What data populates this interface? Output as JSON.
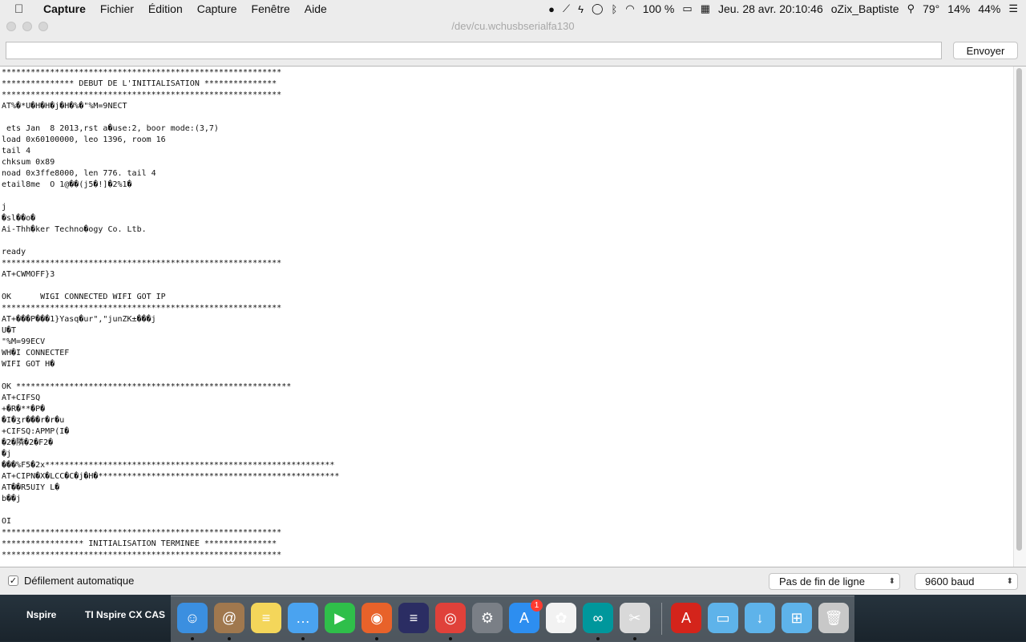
{
  "menubar": {
    "app": "Capture",
    "items": [
      "Fichier",
      "Édition",
      "Capture",
      "Fenêtre",
      "Aide"
    ],
    "battery": "100 %",
    "datetime": "Jeu. 28 avr.  20:10:46",
    "user": "oZix_Baptiste",
    "temperature": "79°",
    "cpu": "14%",
    "mem": "44%"
  },
  "window": {
    "title": "/dev/cu.wchusbserialfa130",
    "send_placeholder": "",
    "send_label": "Envoyer",
    "autoscroll_label": "Défilement automatique",
    "autoscroll_checked": true,
    "line_ending": "Pas de fin de ligne",
    "baud": "9600 baud"
  },
  "console_lines": [
    "**********************************************************",
    "*************** DEBUT DE L'INITIALISATION ***************",
    "**********************************************************",
    "AT%�*U�H�H�j�H�%�\"%M=9NECT",
    "",
    " ets Jan  8 2013,rst a�use:2, boor mode:(3,7)",
    "load 0x60100000, leo 1396, room 16",
    "tail 4",
    "chksum 0x89",
    "noad 0x3ffe8000, len 776. tail 4",
    "etail8me  O 1@��(j5�!]�2%1�",
    "",
    "j",
    "�sl��o�",
    "Ai-Thh�ker Techno�ogy Co. Ltb.",
    "",
    "ready",
    "**********************************************************",
    "AT+CWMOFF}3",
    "",
    "OK      WIGI CONNECTED WIFI GOT IP",
    "**********************************************************",
    "AT+���P���1}Yasq�ur\",\"junZK±���j",
    "U�T",
    "\"%M=99ECV",
    "WH�I CONNECTEF",
    "WIFI GOT H�",
    "",
    "OK *********************************************************",
    "AT+CIFSQ",
    "+�R�**�P�",
    "�I�ʒr���r�r�u",
    "+CIFSQ:APMP(I�",
    "�2�隣�2�F2�",
    "�j",
    "���%F5�2x************************************************************",
    "AT+CIPN�X�LCC�C�j�H�**************************************************",
    "AT��R5UIY L�",
    "b��j",
    "",
    "OI",
    "**********************************************************",
    "***************** INITIALISATION TERMINEE ***************",
    "**********************************************************"
  ],
  "desktop": {
    "label_left": "Nspire",
    "label_right": "TI Nspire CX CAS"
  },
  "dock": {
    "appstore_badge": "1",
    "icons": [
      {
        "name": "finder-icon",
        "color": "#3b8fe0",
        "glyph": "☺",
        "running": true
      },
      {
        "name": "contacts-icon",
        "color": "#a0784e",
        "glyph": "@",
        "running": true
      },
      {
        "name": "notes-icon",
        "color": "#f4d65a",
        "glyph": "≡",
        "running": false
      },
      {
        "name": "messages-icon",
        "color": "#4aa3f0",
        "glyph": "…",
        "running": true
      },
      {
        "name": "facetime-icon",
        "color": "#2fbf4a",
        "glyph": "▶",
        "running": false
      },
      {
        "name": "firefox-icon",
        "color": "#e8622a",
        "glyph": "◉",
        "running": true
      },
      {
        "name": "eclipse-icon",
        "color": "#2b2d63",
        "glyph": "≡",
        "running": false
      },
      {
        "name": "chrome-icon",
        "color": "#e0413a",
        "glyph": "◎",
        "running": true
      },
      {
        "name": "system-preferences-icon",
        "color": "#7a7f86",
        "glyph": "⚙",
        "running": false
      },
      {
        "name": "app-store-icon",
        "color": "#2d8ef0",
        "glyph": "A",
        "running": false
      },
      {
        "name": "photos-icon",
        "color": "#f2f2f2",
        "glyph": "✿",
        "running": false
      },
      {
        "name": "arduino-icon",
        "color": "#00979c",
        "glyph": "∞",
        "running": true
      },
      {
        "name": "capture-icon",
        "color": "#d9d9d9",
        "glyph": "✂",
        "running": true
      },
      {
        "name": "acrobat-icon",
        "color": "#d4241b",
        "glyph": "A",
        "running": false
      },
      {
        "name": "folder-icon",
        "color": "#5eb3ea",
        "glyph": "▭",
        "running": false
      },
      {
        "name": "downloads-icon",
        "color": "#5eb3ea",
        "glyph": "↓",
        "running": false
      },
      {
        "name": "windows-folder-icon",
        "color": "#5eb3ea",
        "glyph": "⊞",
        "running": false
      },
      {
        "name": "trash-icon",
        "color": "#c8c8c8",
        "glyph": "🗑",
        "running": false
      }
    ]
  }
}
